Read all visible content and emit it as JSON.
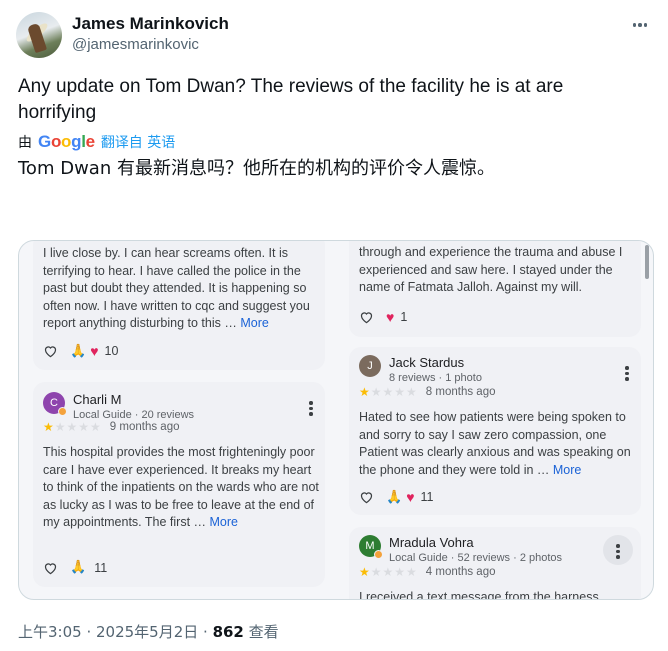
{
  "author": {
    "name": "James Marinkovich",
    "handle": "@jamesmarinkovic"
  },
  "tweet": {
    "text": "Any update on Tom Dwan? The reviews of the facility he is at are horrifying",
    "translate_by": "由",
    "translate_brand": [
      "G",
      "o",
      "o",
      "g",
      "l",
      "e"
    ],
    "translate_label": "翻译自 英语",
    "translated_text": "Tom Dwan 有最新消息吗？他所在的机构的评价令人震惊。"
  },
  "reviews_left": [
    {
      "text": "I live close by. I can hear screams often. It is terrifying to hear. I have called the police in the past but doubt they attended. It is happening so often now. I have written to cqc and suggest you report anything disturbing to this … ",
      "more": "More",
      "react_count": "10"
    },
    {
      "initial": "C",
      "avatar_color": "#8e44ad",
      "name": "Charli M",
      "meta": "Local Guide · 20 reviews",
      "stars": 1,
      "ago": "9 months ago",
      "text": "This hospital provides the most frighteningly poor care I have ever experienced. It breaks my heart to think of the inpatients on the wards who are not as lucky as I was to be free to leave at the end of my appointments. The first … ",
      "more": "More",
      "react_count": "11"
    }
  ],
  "reviews_right": [
    {
      "text": "through and experience the trauma and abuse I experienced and saw here. I stayed under the name of Fatmata Jalloh. Against my will.",
      "react_count": "1"
    },
    {
      "initial": "J",
      "avatar_color": "#7b6b5e",
      "name": "Jack Stardus",
      "meta": "8 reviews · 1 photo",
      "stars": 1,
      "ago": "8 months ago",
      "text": "Hated to see how patients were being spoken to and sorry to say I saw zero compassion, one Patient was clearly anxious and was speaking on the phone and they were told in … ",
      "more": "More",
      "react_count": "11"
    },
    {
      "initial": "M",
      "avatar_color": "#2e7d32",
      "name": "Mradula Vohra",
      "meta": "Local Guide · 52 reviews · 2 photos",
      "stars": 1,
      "ago": "4 months ago",
      "text": "I received a text message from the harness"
    }
  ],
  "footer": {
    "time": "上午3:05 · 2025年5月2日 · ",
    "views": "862",
    "views_label": " 查看"
  }
}
